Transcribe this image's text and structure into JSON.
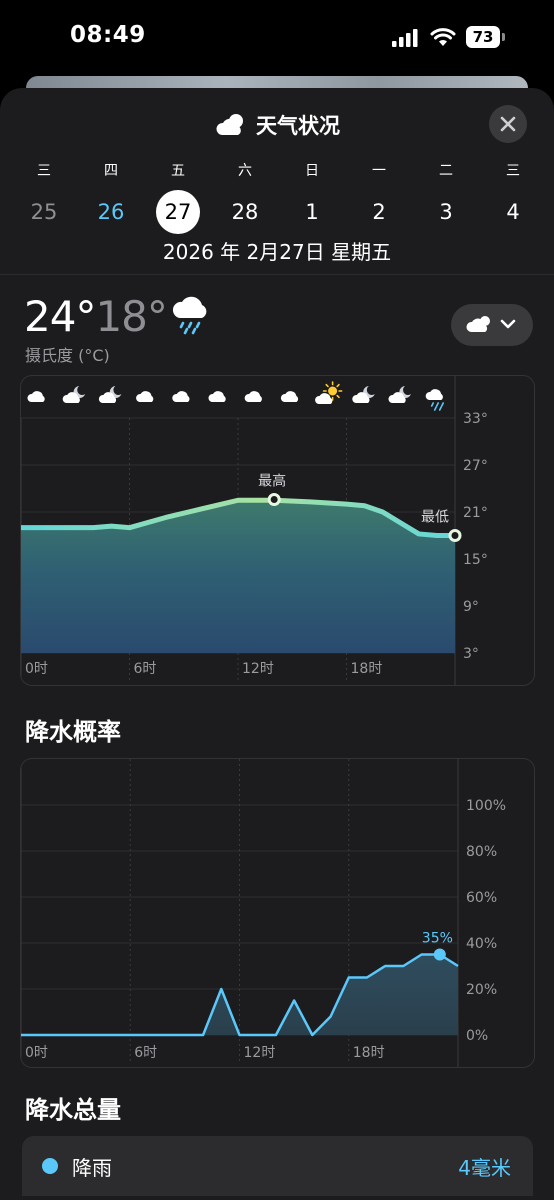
{
  "status_bar": {
    "time": "08:49",
    "battery": "73"
  },
  "sheet": {
    "title": "天气状况",
    "title_icon": "cloud-icon",
    "close_icon": "close-icon"
  },
  "calendar": {
    "days": [
      {
        "weekday": "三",
        "date": "25",
        "state": "past"
      },
      {
        "weekday": "四",
        "date": "26",
        "state": "today"
      },
      {
        "weekday": "五",
        "date": "27",
        "state": "selected"
      },
      {
        "weekday": "六",
        "date": "28",
        "state": "future"
      },
      {
        "weekday": "日",
        "date": "1",
        "state": "future"
      },
      {
        "weekday": "一",
        "date": "2",
        "state": "future"
      },
      {
        "weekday": "二",
        "date": "3",
        "state": "future"
      },
      {
        "weekday": "三",
        "date": "4",
        "state": "future"
      }
    ],
    "full_date": "2026 年 2月27日 星期五"
  },
  "summary": {
    "high": "24°",
    "low": "18°",
    "unit": "摄氏度 (°C)",
    "condition_icon": "cloud-rain-icon"
  },
  "colors": {
    "accent": "#5ac8fa",
    "background": "#1c1c1e",
    "temp_curve_low": "#6ad6d6",
    "temp_curve_high": "#a6e0a0"
  },
  "temp_chart": {
    "hourly_icons": [
      "cloud-icon",
      "cloud-moon-icon",
      "cloud-moon-icon",
      "cloud-icon",
      "cloud-icon",
      "cloud-icon",
      "cloud-icon",
      "cloud-icon",
      "cloud-sun-icon",
      "cloud-moon-icon",
      "cloud-moon-icon",
      "cloud-rain-icon"
    ],
    "high_label": "最高",
    "low_label": "最低",
    "y_ticks": [
      "33°",
      "27°",
      "21°",
      "15°",
      "9°",
      "3°"
    ],
    "x_ticks": [
      "0时",
      "6时",
      "12时",
      "18时"
    ]
  },
  "precip": {
    "title": "降水概率",
    "peak_label": "35%",
    "y_ticks": [
      "100%",
      "80%",
      "60%",
      "40%",
      "20%",
      "0%"
    ],
    "x_ticks": [
      "0时",
      "6时",
      "12时",
      "18时"
    ]
  },
  "total": {
    "title": "降水总量",
    "rain_label": "降雨",
    "rain_value": "4毫米"
  },
  "chart_data": [
    {
      "type": "area",
      "xlabel": "",
      "ylabel": "",
      "xlim": [
        0,
        24
      ],
      "ylim": [
        3,
        33
      ],
      "grid": true,
      "x": [
        0,
        2,
        4,
        5,
        6,
        8,
        10,
        12,
        14,
        16,
        18,
        19,
        20,
        21,
        22,
        23,
        24
      ],
      "y": [
        19.0,
        19.0,
        19.0,
        19.2,
        19.0,
        20.3,
        21.4,
        22.5,
        22.5,
        22.3,
        22.0,
        21.8,
        21.0,
        19.6,
        18.2,
        18.0,
        18.0
      ],
      "annotations": [
        {
          "label": "最高",
          "x": 14,
          "y": 22.6
        },
        {
          "label": "最低",
          "x": 24,
          "y": 18.0
        }
      ]
    },
    {
      "type": "area",
      "xlabel": "",
      "ylabel": "",
      "xlim": [
        0,
        24
      ],
      "ylim": [
        0,
        100
      ],
      "grid": true,
      "x": [
        0,
        1,
        2,
        3,
        4,
        5,
        6,
        7,
        8,
        9,
        10,
        11,
        12,
        13,
        14,
        15,
        16,
        17,
        18,
        19,
        20,
        21,
        22,
        23,
        24
      ],
      "y": [
        0,
        0,
        0,
        0,
        0,
        0,
        0,
        0,
        0,
        0,
        0,
        20,
        0,
        0,
        0,
        15,
        0,
        8,
        25,
        25,
        30,
        30,
        35,
        35,
        30
      ],
      "annotations": [
        {
          "label": "35%",
          "x": 23,
          "y": 35
        }
      ]
    }
  ]
}
